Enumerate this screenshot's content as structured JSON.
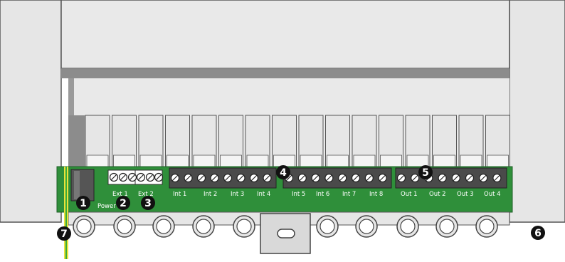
{
  "labels": {
    "power": "Power",
    "ext1": "Ext 1",
    "ext2": "Ext 2",
    "inputs": [
      "Int 1",
      "Int 2",
      "Int 3",
      "Int 4",
      "Int 5",
      "Int 6",
      "Int 7",
      "Int 8"
    ],
    "outputs": [
      "Out 1",
      "Out 2",
      "Out 3",
      "Out 4"
    ]
  },
  "callouts": [
    "1",
    "2",
    "3",
    "4",
    "5",
    "6",
    "7"
  ],
  "colors": {
    "pcb": "#2f8f3a",
    "housing": "#e6e6e6",
    "housing_dark": "#8c8c8c",
    "terminal_dark": "#4a4a4a",
    "ground_wire": "#e8e23a",
    "ground_stripe": "#3aaa3a"
  }
}
